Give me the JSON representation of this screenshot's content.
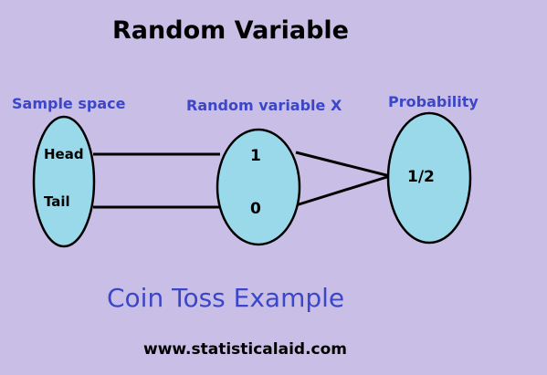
{
  "title": "Random Variable",
  "headers": {
    "sample_space": "Sample space",
    "random_variable": "Random variable X",
    "probability": "Probability"
  },
  "nodes": {
    "head": "Head",
    "tail": "Tail",
    "one": "1",
    "zero": "0",
    "half": "1/2"
  },
  "caption": "Coin Toss Example",
  "website": "www.statisticalaid.com",
  "colors": {
    "background": "#c9bfe6",
    "ellipse_fill": "#99d9ea",
    "heading_text": "#3c46c8",
    "lines": "#000000"
  }
}
